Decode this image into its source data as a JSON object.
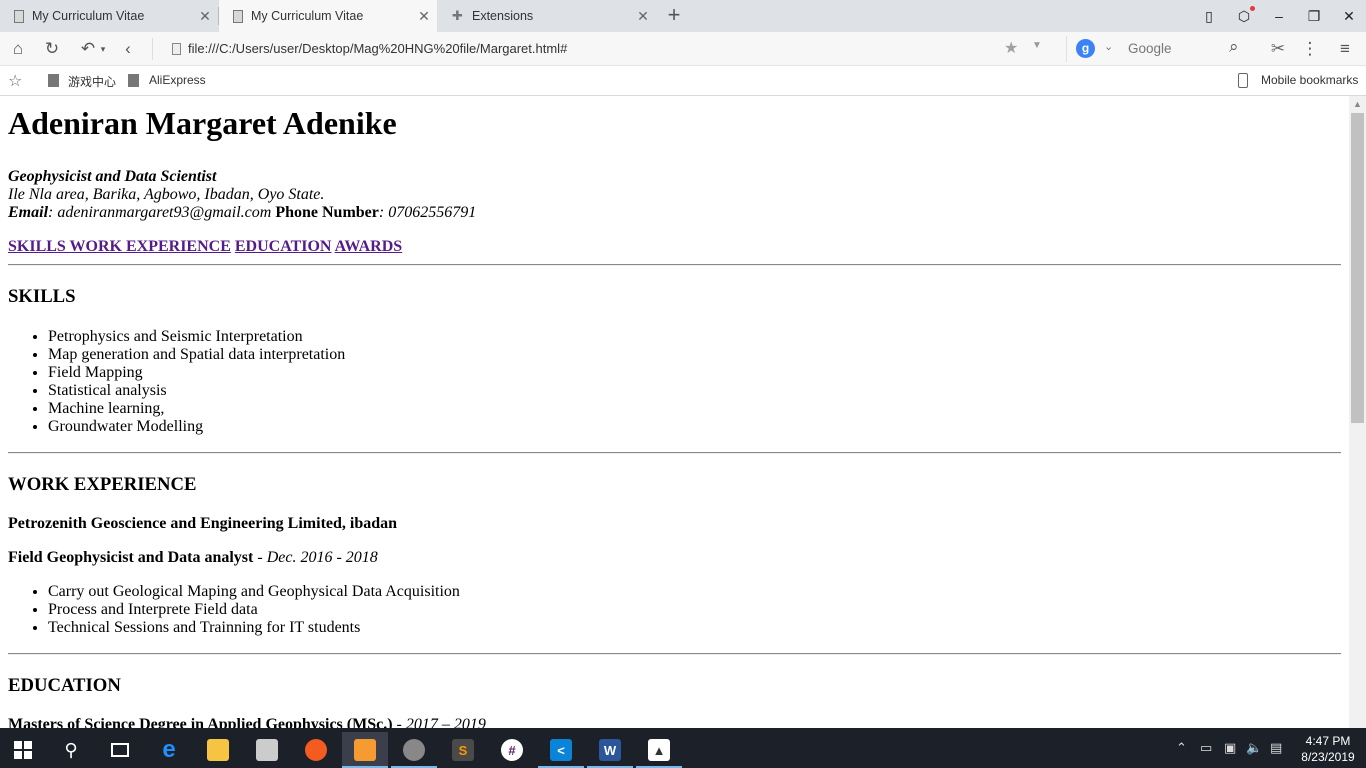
{
  "browser": {
    "tabs": [
      {
        "title": "My Curriculum Vitae",
        "icon": "document-icon"
      },
      {
        "title": "My Curriculum Vitae",
        "icon": "document-icon"
      },
      {
        "title": "Extensions",
        "icon": "puzzle-icon"
      }
    ],
    "url": "file:///C:/Users/user/Desktop/Mag%20HNG%20file/Margaret.html#",
    "search_engine_label": "Google",
    "bookmarks": [
      {
        "label": "游戏中心"
      },
      {
        "label": "AliExpress"
      }
    ],
    "mobile_bookmarks": "Mobile bookmarks"
  },
  "page": {
    "name": "Adeniran Margaret Adenike",
    "title": "Geophysicist and Data Scientist",
    "address": "Ile Nla area, Barika, Agbowo, Ibadan, Oyo State.",
    "email_label": "Email",
    "email": ": adeniranmargaret93@gmail.com",
    "phone_label": "Phone Number",
    "phone": ": 07062556791",
    "nav": {
      "skills_work": "SKILLS WORK EXPERIENCE",
      "education": "EDUCATION",
      "awards": "AWARDS"
    },
    "skills": {
      "heading": "SKILLS",
      "items": [
        "Petrophysics and Seismic Interpretation",
        "Map generation and Spatial data interpretation",
        "Field Mapping",
        "Statistical analysis",
        "Machine learning,",
        "Groundwater Modelling"
      ]
    },
    "work": {
      "heading": "WORK EXPERIENCE",
      "company": "Petrozenith Geoscience and Engineering Limited, ibadan",
      "role": "Field Geophysicist and Data analyst",
      "role_sep": " - ",
      "dates": "Dec. 2016 - 2018",
      "items": [
        "Carry out Geological Maping and Geophysical Data Acquisition",
        "Process and Interprete Field data",
        "Technical Sessions and Trainning for IT students"
      ]
    },
    "education": {
      "heading": "EDUCATION",
      "degree": "Masters of Science Degree in Applied Geophysics (MSc.)",
      "sep": " - ",
      "dates": "2017 – 2019"
    }
  },
  "taskbar": {
    "time": "4:47 PM",
    "date": "8/23/2019"
  }
}
